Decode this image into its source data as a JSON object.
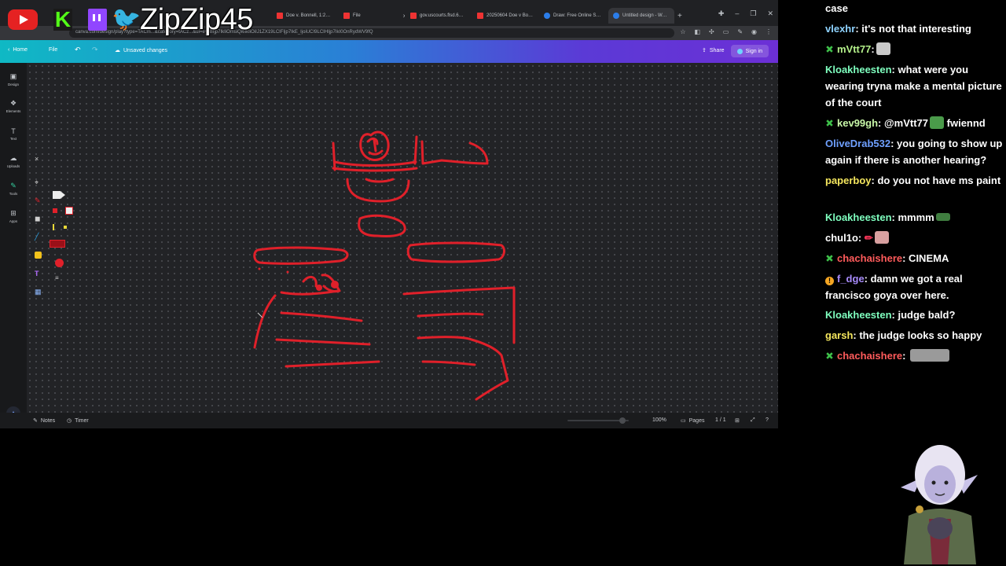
{
  "overlay": {
    "streamer_name": "ZipZip45",
    "platform_icons": [
      "youtube-icon",
      "kick-icon",
      "twitch-icon",
      "twitter-icon"
    ]
  },
  "browser": {
    "tabs": [
      {
        "label": "Doe v. Bonnell, 1:2…",
        "icon": "pdf-icon"
      },
      {
        "label": "File",
        "icon": "pdf-icon"
      },
      {
        "label": "gov.uscourts.flsd.6…",
        "icon": "pdf-icon"
      },
      {
        "label": "20250604 Doe v Bo…",
        "icon": "pdf-icon"
      },
      {
        "label": "Draw: Free Online S…",
        "icon": "canva-icon"
      },
      {
        "label": "Untitled design - W…",
        "icon": "canva-icon"
      }
    ],
    "url": "canva.com/design/play?type=TACm...&category=tACz...&ui=eyJBIjp7IkIiOmsiQi6IkIiOiIJ1ZX19LCIFIjp7IkE_IjoiUCI9LCIHIjp7IkI0OnRydWV9fQ"
  },
  "canva_header": {
    "home_label": "Home",
    "file_label": "File",
    "save_status": "Unsaved changes",
    "share_label": "Share",
    "signin_label": "Sign in"
  },
  "sidebar": {
    "items": [
      {
        "label": "Design",
        "icon": "design-icon"
      },
      {
        "label": "Elements",
        "icon": "elements-icon"
      },
      {
        "label": "Text",
        "icon": "text-icon"
      },
      {
        "label": "Uploads",
        "icon": "uploads-icon"
      },
      {
        "label": "Tools",
        "icon": "tools-icon"
      },
      {
        "label": "Apps",
        "icon": "apps-icon"
      }
    ]
  },
  "draw_tools": {
    "accent_color": "#e0202a"
  },
  "bottom_bar": {
    "notes_label": "Notes",
    "timer_label": "Timer",
    "zoom": "100%",
    "pages_label": "Pages",
    "page_count": "1 / 1"
  },
  "chat": {
    "messages": [
      {
        "user": "",
        "user_color": "#ffffff",
        "text": "case",
        "badge": ""
      },
      {
        "user": "vlexhr",
        "user_color": "#8fd3ff",
        "text": ": it's not that interesting",
        "badge": ""
      },
      {
        "user": "mVtt77",
        "user_color": "#b4f08a",
        "text": ":",
        "badge": "plus",
        "emote": "ghost-emote"
      },
      {
        "user": "Kloakheesten",
        "user_color": "#7fffbf",
        "text": ": what were you wearing tryna make a mental picture of the court",
        "badge": ""
      },
      {
        "user": "kev99gh",
        "user_color": "#c8f7a8",
        "text": ": @mVtt77",
        "badge": "plus",
        "emote": "pepe-emote",
        "text2": "fwiennd"
      },
      {
        "user": "OliveDrab532",
        "user_color": "#6fa0ff",
        "text": ": you going to show up again if there is another hearing?",
        "badge": ""
      },
      {
        "user": "paperboy",
        "user_color": "#f5e75e",
        "text": ": do you not have ms paint",
        "badge": ""
      },
      {
        "user": "Kloakheesten",
        "user_color": "#7fffbf",
        "text": ": mmmm",
        "badge": "",
        "emote": "frog-emote"
      },
      {
        "user": "chul1o",
        "user_color": "#ffffff",
        "text": ":",
        "badge": "",
        "emote": "cat-emote"
      },
      {
        "user": "chachaishere",
        "user_color": "#ff5b5b",
        "text": ": CINEMA",
        "badge": "plus"
      },
      {
        "user": "f_dge",
        "user_color": "#a78bfa",
        "text": ": damn we got a real francisco goya over here.",
        "badge": "warn"
      },
      {
        "user": "Kloakheesten",
        "user_color": "#7fffbf",
        "text": ": judge bald?",
        "badge": ""
      },
      {
        "user": "garsh",
        "user_color": "#f5e75e",
        "text": ": the judge looks so happy",
        "badge": ""
      },
      {
        "user": "chachaishere",
        "user_color": "#ff5b5b",
        "text": ":",
        "badge": "plus",
        "emote": "photo-emote"
      }
    ]
  }
}
